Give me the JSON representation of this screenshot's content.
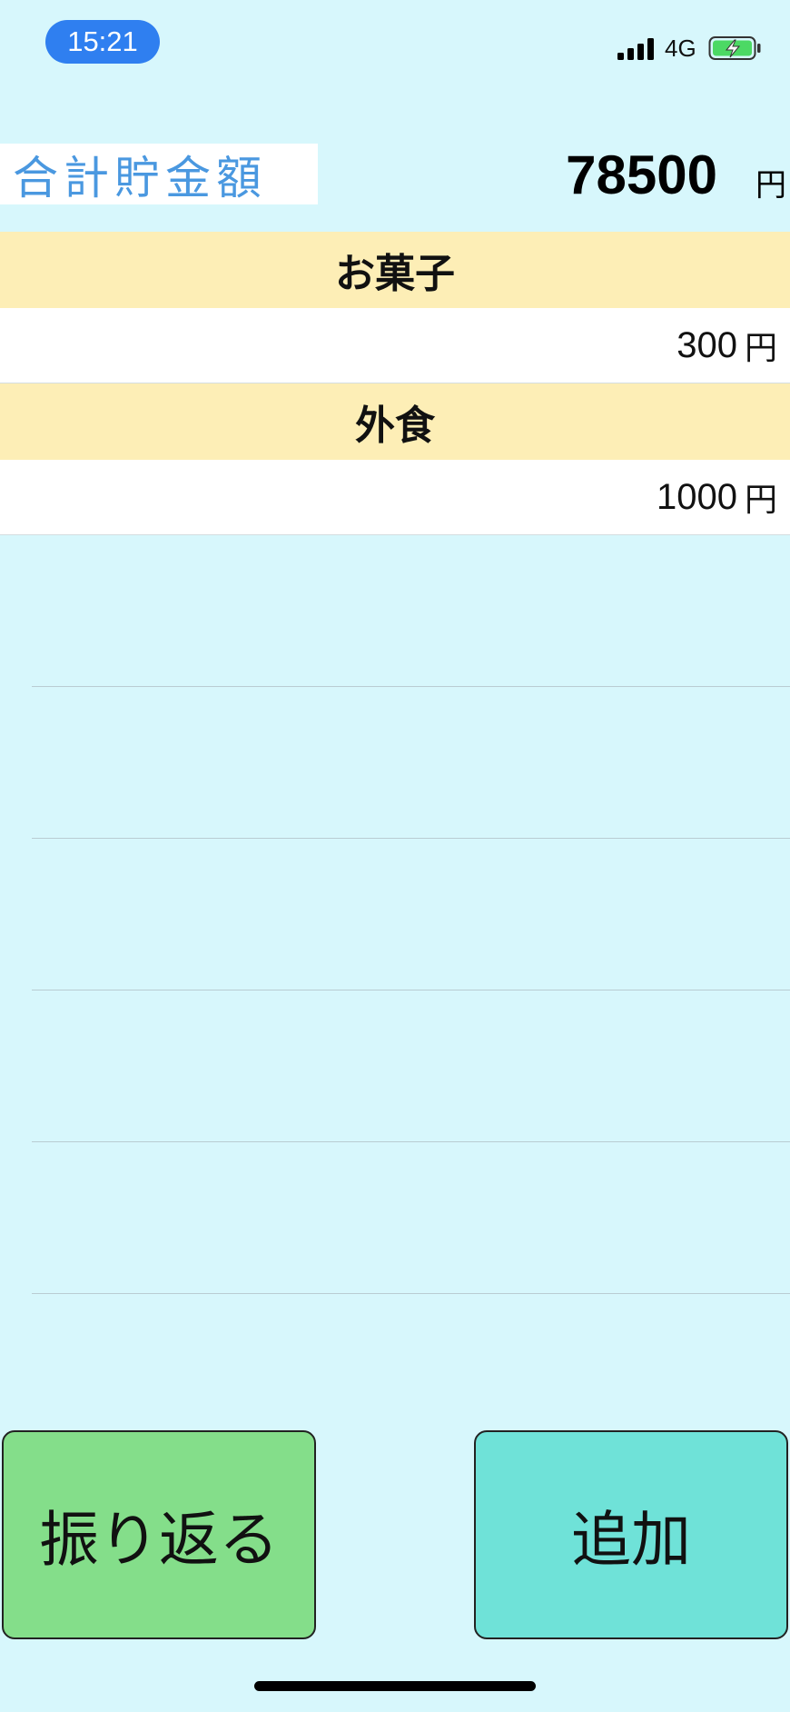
{
  "status_bar": {
    "time": "15:21",
    "network": "4G"
  },
  "summary": {
    "label": "合計貯金額",
    "value": "78500",
    "unit": "円"
  },
  "sections": [
    {
      "title": "お菓子",
      "amount": "300",
      "unit": "円"
    },
    {
      "title": "外食",
      "amount": "1000",
      "unit": "円"
    }
  ],
  "buttons": {
    "review_label": "振り返る",
    "add_label": "追加"
  },
  "colors": {
    "background": "#d7f7fc",
    "section_header": "#fdeeb6",
    "review_button": "#84de8a",
    "add_button": "#6fe2d8",
    "summary_label_text": "#4a98e0",
    "time_pill": "#2f7ff0"
  }
}
